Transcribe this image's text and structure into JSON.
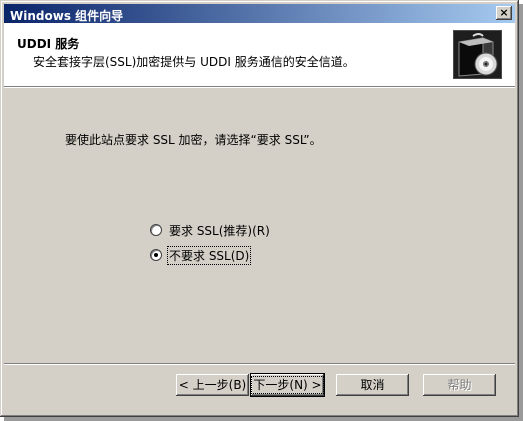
{
  "window": {
    "title": "Windows 组件向导",
    "close_label": "×"
  },
  "header": {
    "title": "UDDI 服务",
    "subtitle": "安全套接字层(SSL)加密提供与 UDDI 服务通信的安全信道。",
    "icon": "software-box-cd-icon"
  },
  "content": {
    "instruction": "要使此站点要求 SSL 加密，请选择“要求 SSL”。",
    "options": [
      {
        "label": "要求 SSL(推荐)(R)",
        "checked": false
      },
      {
        "label": "不要求 SSL(D)",
        "checked": true
      }
    ]
  },
  "buttons": {
    "back": "< 上一步(B)",
    "next": "下一步(N) >",
    "cancel": "取消",
    "help": "帮助"
  }
}
